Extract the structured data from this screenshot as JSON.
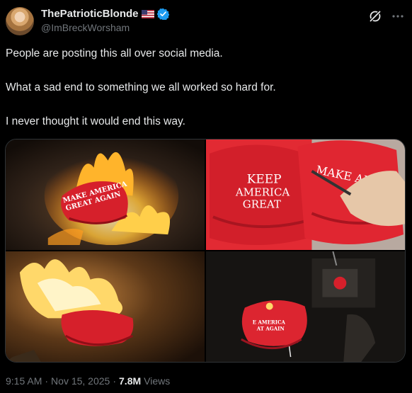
{
  "author": {
    "display_name": "ThePatrioticBlonde",
    "handle": "@ImBreckWorsham"
  },
  "tweet": {
    "paragraphs": [
      "People are posting this all over social media.",
      "What a sad end to something we all worked so hard for.",
      "I never thought it would end this way."
    ]
  },
  "media": {
    "hat_text_1": "MAKE AMERICA",
    "hat_text_2": "GREAT AGAIN",
    "hat_keep_1": "KEEP",
    "hat_keep_2": "AMERICA",
    "hat_keep_3": "GREAT",
    "hat_make": "MAKE AM",
    "hat_dark_1": "E AMERICA",
    "hat_dark_2": "AT AGAIN"
  },
  "meta": {
    "time": "9:15 AM",
    "separator1": "·",
    "date": "Nov 15, 2025",
    "separator2": "·",
    "views_count": "7.8M",
    "views_label": "Views"
  },
  "colors": {
    "background": "#000000",
    "text": "#e7e9ea",
    "secondary": "#71767b",
    "verified": "#1d9bf0",
    "hat_red": "#d6202b"
  }
}
